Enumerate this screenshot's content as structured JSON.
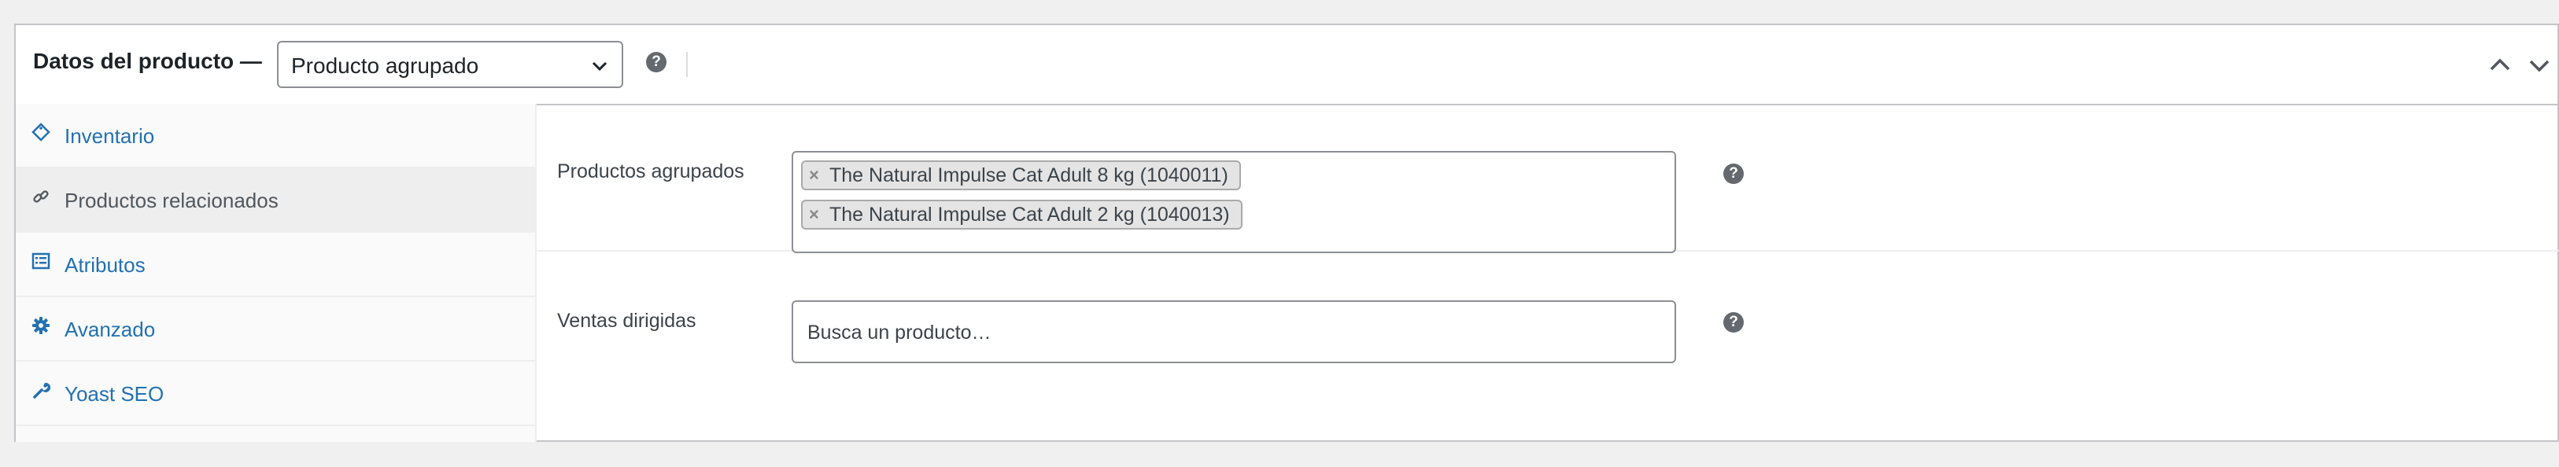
{
  "header": {
    "title": "Datos del producto —",
    "product_type_selected": "Producto agrupado",
    "help_glyph": "?",
    "icons": [
      "help-icon",
      "chevron-up-icon",
      "chevron-down-icon"
    ]
  },
  "tabs": [
    {
      "label": "Inventario",
      "icon": "tag-icon",
      "active": false
    },
    {
      "label": "Productos relacionados",
      "icon": "link-icon",
      "active": true
    },
    {
      "label": "Atributos",
      "icon": "list-icon",
      "active": false
    },
    {
      "label": "Avanzado",
      "icon": "gear-icon",
      "active": false
    },
    {
      "label": "Yoast SEO",
      "icon": "wrench-icon",
      "active": false
    }
  ],
  "fields": {
    "grouped": {
      "label": "Productos agrupados",
      "chip_remove": "×",
      "items": [
        "The Natural Impulse Cat Adult 8 kg (1040011)",
        "The Natural Impulse Cat Adult 2 kg (1040013)"
      ]
    },
    "upsells": {
      "label": "Ventas dirigidas",
      "placeholder": "Busca un producto…"
    }
  },
  "colors": {
    "link": "#2271b1",
    "border": "#c3c4c7",
    "background": "#f0f0f1",
    "active_tab": "#eeeeee"
  }
}
